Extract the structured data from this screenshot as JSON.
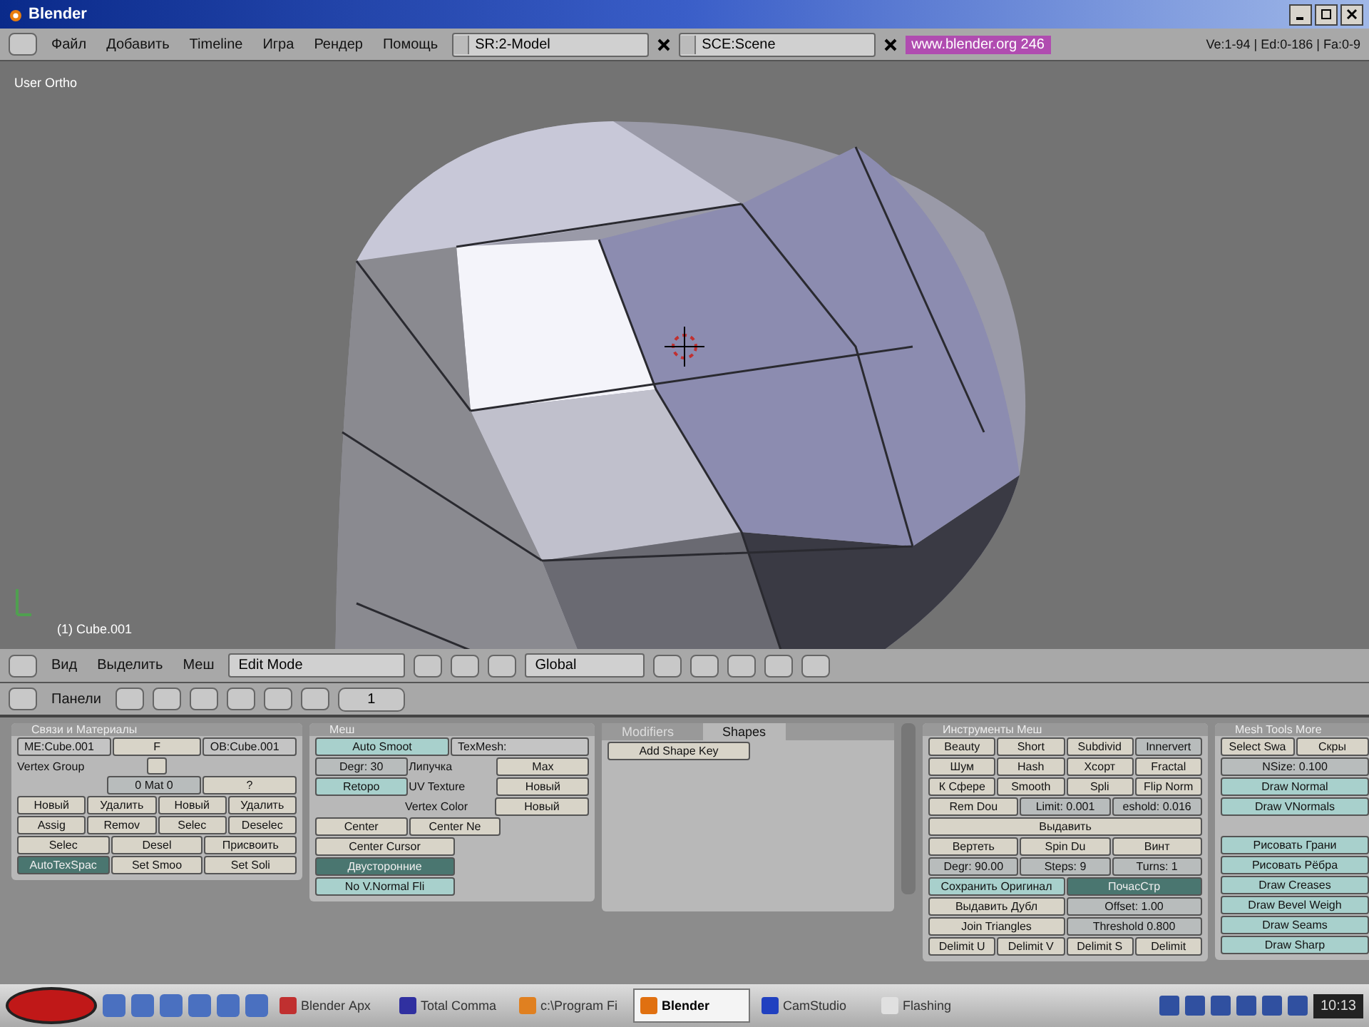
{
  "title_bar": {
    "title": "Blender"
  },
  "menu_bar": {
    "menus": [
      "Файл",
      "Добавить",
      "Timeline",
      "Игра",
      "Рендер",
      "Помощь"
    ],
    "screen": "SR:2-Model",
    "scene": "SCE:Scene",
    "link": "www.blender.org 246",
    "stats": "Ve:1-94 | Ed:0-186 | Fa:0-9"
  },
  "viewport": {
    "view_label": "User Ortho",
    "object_label": "(1) Cube.001"
  },
  "view_header": {
    "menus": [
      "Вид",
      "Выделить",
      "Меш"
    ],
    "mode": "Edit Mode",
    "orientation": "Global"
  },
  "buttons_header": {
    "label": "Панели",
    "frame": "1"
  },
  "panels": [
    {
      "title": "Связи и Материалы",
      "rows": [
        [
          {
            "kind": "field",
            "label": "ME:Cube.001"
          },
          {
            "kind": "button",
            "label": "F"
          },
          {
            "kind": "field",
            "label": "OB:Cube.001"
          }
        ],
        [
          {
            "kind": "text",
            "label": "Vertex Group"
          },
          {
            "kind": "icon"
          },
          {
            "kind": "gap"
          }
        ],
        [
          {
            "kind": "gap"
          },
          {
            "kind": "number",
            "label": "0 Mat 0"
          },
          {
            "kind": "button",
            "label": "?"
          }
        ],
        [
          {
            "kind": "button",
            "label": "Новый"
          },
          {
            "kind": "button",
            "label": "Удалить"
          },
          {
            "kind": "button",
            "label": "Новый"
          },
          {
            "kind": "button",
            "label": "Удалить"
          }
        ],
        [
          {
            "kind": "button",
            "label": "Assig"
          },
          {
            "kind": "button",
            "label": "Remov"
          },
          {
            "kind": "button",
            "label": "Selec"
          },
          {
            "kind": "button",
            "label": "Deselec"
          }
        ],
        [
          {
            "kind": "button",
            "label": "Selec"
          },
          {
            "kind": "button",
            "label": "Desel"
          },
          {
            "kind": "button",
            "label": "Присвоить"
          }
        ],
        [
          {
            "kind": "toggle",
            "label": "AutoTexSpac",
            "on": true
          },
          {
            "kind": "button",
            "label": "Set Smoo"
          },
          {
            "kind": "button",
            "label": "Set Soli"
          }
        ]
      ]
    },
    {
      "title": "Меш",
      "rows": [
        [
          {
            "kind": "toggle",
            "label": "Auto Smoot",
            "on": false
          },
          {
            "kind": "field",
            "label": "TexMesh:"
          }
        ],
        [
          {
            "kind": "number",
            "label": "Degr: 30"
          },
          {
            "kind": "text",
            "label": "Липучка"
          },
          {
            "kind": "button",
            "label": "Мах"
          }
        ],
        [
          {
            "kind": "toggle",
            "label": "Retopo",
            "on": false
          },
          {
            "kind": "text",
            "label": "UV Texture"
          },
          {
            "kind": "button",
            "label": "Новый"
          }
        ],
        [
          {
            "kind": "gap"
          },
          {
            "kind": "text",
            "label": "Vertex Color"
          },
          {
            "kind": "button",
            "label": "Новый"
          }
        ],
        [
          {
            "kind": "button",
            "label": "Center"
          },
          {
            "kind": "button",
            "label": "Center Ne"
          },
          {
            "kind": "gap"
          }
        ],
        [
          {
            "kind": "button",
            "label": "Center Cursor"
          },
          {
            "kind": "gap"
          }
        ],
        [
          {
            "kind": "toggle",
            "label": "Двусторонние",
            "on": true
          },
          {
            "kind": "gap"
          }
        ],
        [
          {
            "kind": "toggle",
            "label": "No V.Normal Fli",
            "on": false
          },
          {
            "kind": "gap"
          }
        ]
      ]
    },
    {
      "tabs": [
        {
          "label": "Modifiers",
          "selected": false
        },
        {
          "label": "Shapes",
          "selected": true
        }
      ],
      "rows": [
        [
          {
            "kind": "button",
            "label": "Add Shape Key"
          },
          {
            "kind": "gap"
          }
        ]
      ]
    },
    {
      "title": "Инструменты Меш",
      "rows": [
        [
          {
            "kind": "button",
            "label": "Beauty"
          },
          {
            "kind": "button",
            "label": "Short"
          },
          {
            "kind": "button",
            "label": "Subdivid"
          },
          {
            "kind": "number",
            "label": "Innervert"
          }
        ],
        [
          {
            "kind": "button",
            "label": "Шум"
          },
          {
            "kind": "button",
            "label": "Hash"
          },
          {
            "kind": "button",
            "label": "Xсорт"
          },
          {
            "kind": "button",
            "label": "Fractal"
          }
        ],
        [
          {
            "kind": "button",
            "label": "К Сфере"
          },
          {
            "kind": "button",
            "label": "Smooth"
          },
          {
            "kind": "button",
            "label": "Spli"
          },
          {
            "kind": "button",
            "label": "Flip Norm"
          }
        ],
        [
          {
            "kind": "button",
            "label": "Rem Dou"
          },
          {
            "kind": "number",
            "label": "Limit: 0.001"
          },
          {
            "kind": "number",
            "label": "eshold: 0.016"
          }
        ],
        [
          {
            "kind": "button",
            "label": "Выдавить"
          }
        ],
        [
          {
            "kind": "button",
            "label": "Вертеть"
          },
          {
            "kind": "button",
            "label": "Spin Du"
          },
          {
            "kind": "button",
            "label": "Винт"
          }
        ],
        [
          {
            "kind": "number",
            "label": "Degr: 90.00"
          },
          {
            "kind": "number",
            "label": "Steps: 9"
          },
          {
            "kind": "number",
            "label": "Turns: 1"
          }
        ],
        [
          {
            "kind": "toggle",
            "label": "Сохранить Оригинал",
            "on": false
          },
          {
            "kind": "toggle",
            "label": "ПочасСтр",
            "on": true
          }
        ],
        [
          {
            "kind": "button",
            "label": "Выдавить Дубл"
          },
          {
            "kind": "number",
            "label": "Offset: 1.00"
          }
        ],
        [
          {
            "kind": "button",
            "label": "Join Triangles"
          },
          {
            "kind": "number",
            "label": "Threshold 0.800"
          }
        ],
        [
          {
            "kind": "button",
            "label": "Delimit U"
          },
          {
            "kind": "button",
            "label": "Delimit V"
          },
          {
            "kind": "button",
            "label": "Delimit S"
          },
          {
            "kind": "button",
            "label": "Delimit"
          }
        ]
      ]
    },
    {
      "title": "Mesh Tools More",
      "rows": [
        [
          {
            "kind": "button",
            "label": "Select Swa"
          },
          {
            "kind": "button",
            "label": "Скры"
          }
        ],
        [
          {
            "kind": "number",
            "label": "NSize: 0.100"
          }
        ],
        [
          {
            "kind": "toggle",
            "label": "Draw Normal",
            "on": false
          }
        ],
        [
          {
            "kind": "toggle",
            "label": "Draw VNormals",
            "on": false
          }
        ],
        [
          {
            "kind": "gap"
          }
        ],
        [
          {
            "kind": "toggle",
            "label": "Рисовать Грани",
            "on": false
          }
        ],
        [
          {
            "kind": "toggle",
            "label": "Рисовать Рёбра",
            "on": false
          }
        ],
        [
          {
            "kind": "toggle",
            "label": "Draw Creases",
            "on": false
          }
        ],
        [
          {
            "kind": "toggle",
            "label": "Draw Bevel Weigh",
            "on": false
          }
        ],
        [
          {
            "kind": "toggle",
            "label": "Draw Seams",
            "on": false
          }
        ],
        [
          {
            "kind": "toggle",
            "label": "Draw Sharp",
            "on": false
          }
        ]
      ]
    }
  ],
  "taskbar": {
    "tasks": [
      {
        "label": "Blender Арх",
        "selected": false,
        "color": "#c03030"
      },
      {
        "label": "Total Comma",
        "selected": false,
        "color": "#3030a0"
      },
      {
        "label": "c:\\Program Fi",
        "selected": false,
        "color": "#e08020"
      },
      {
        "label": "Blender",
        "selected": true,
        "color": "#e07010"
      },
      {
        "label": "CamStudio",
        "selected": false,
        "color": "#2040c0"
      },
      {
        "label": "Flashing",
        "selected": false,
        "color": "#e0e0e0"
      }
    ],
    "clock": "10:13"
  }
}
